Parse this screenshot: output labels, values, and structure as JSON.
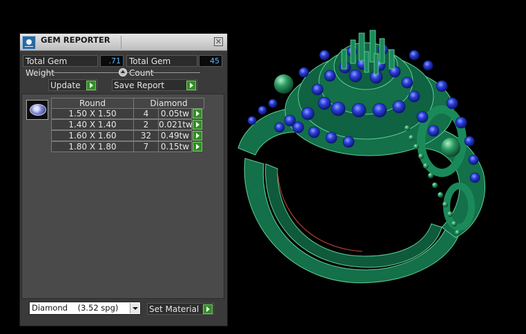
{
  "window": {
    "title": "GEM REPORTER",
    "close_label": "✕"
  },
  "stats": {
    "weight_label": "Total Gem Weight",
    "weight_value": ".71",
    "count_label": "Total Gem Count",
    "count_value": "45"
  },
  "actions": {
    "update_label": "Update",
    "save_label": "Save Report"
  },
  "table": {
    "headers": [
      "Round",
      "Diamond"
    ],
    "rows": [
      {
        "size": "1.50 X 1.50",
        "count": "4",
        "weight": "0.05tw"
      },
      {
        "size": "1.40 X 1.40",
        "count": "2",
        "weight": "0.021tw"
      },
      {
        "size": "1.60 X 1.60",
        "count": "32",
        "weight": "0.49tw"
      },
      {
        "size": "1.80 X 1.80",
        "count": "7",
        "weight": "0.15tw"
      }
    ]
  },
  "material": {
    "selected": "Diamond    (3.52 spg)",
    "set_label": "Set Material"
  },
  "icons": {
    "app": "gem-reporter-app-icon",
    "gem": "round-gem-icon",
    "go": "green-play-arrow-icon",
    "dropdown": "chevron-down-icon",
    "close": "close-icon"
  },
  "colors": {
    "ring": "#167a52",
    "gems": "#2a3ed8",
    "value_text": "#62b8ff",
    "accent_button": "#2f8f22",
    "panel": "#3a3a3a"
  }
}
